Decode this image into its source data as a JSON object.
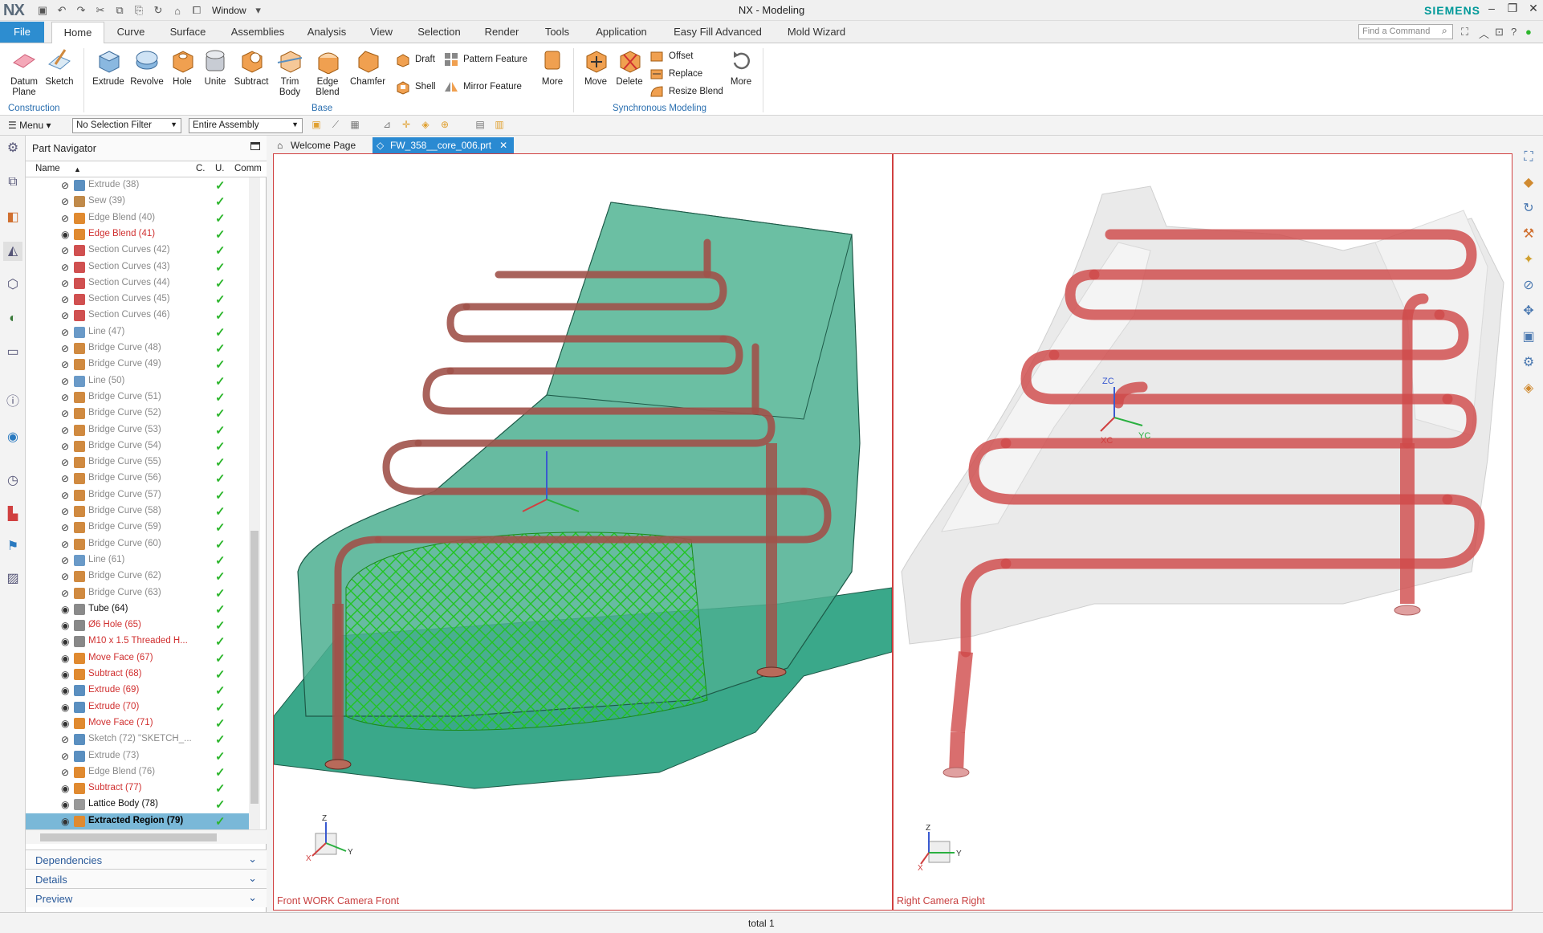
{
  "app": {
    "logo": "NX",
    "title": "NX - Modeling",
    "brand": "SIEMENS",
    "window_menu": "Window"
  },
  "tabs": {
    "file": "File",
    "items": [
      "Home",
      "Curve",
      "Surface",
      "Assemblies",
      "Analysis",
      "View",
      "Selection",
      "Render",
      "Tools",
      "Application",
      "Easy Fill Advanced",
      "Mold Wizard"
    ],
    "active": "Home",
    "find_placeholder": "Find a Command"
  },
  "ribbon": {
    "construction": {
      "group": "Construction",
      "datum": "Datum\nPlane",
      "sketch": "Sketch"
    },
    "base": {
      "group": "Base",
      "extrude": "Extrude",
      "revolve": "Revolve",
      "hole": "Hole",
      "unite": "Unite",
      "subtract": "Subtract",
      "trim_body": "Trim\nBody",
      "edge_blend": "Edge\nBlend",
      "chamfer": "Chamfer",
      "draft": "Draft",
      "shell": "Shell",
      "pattern": "Pattern Feature",
      "mirror": "Mirror Feature",
      "more": "More"
    },
    "sync": {
      "group": "Synchronous Modeling",
      "move": "Move",
      "delete": "Delete",
      "offset": "Offset",
      "replace": "Replace",
      "resize_blend": "Resize Blend",
      "more": "More"
    }
  },
  "selbar": {
    "menu": "Menu",
    "filter": "No Selection Filter",
    "scope": "Entire Assembly"
  },
  "navigator": {
    "title": "Part Navigator",
    "columns": {
      "name": "Name",
      "c": "C.",
      "u": "U.",
      "comment": "Comm"
    },
    "rows": [
      {
        "label": "Extrude (38)",
        "style": "gray",
        "icon": "#5a8fc0"
      },
      {
        "label": "Sew (39)",
        "style": "gray",
        "icon": "#c08a4a"
      },
      {
        "label": "Edge Blend (40)",
        "style": "gray",
        "icon": "#e08a30"
      },
      {
        "label": "Edge Blend (41)",
        "style": "red",
        "icon": "#e08a30"
      },
      {
        "label": "Section Curves (42)",
        "style": "gray",
        "icon": "#d05050"
      },
      {
        "label": "Section Curves (43)",
        "style": "gray",
        "icon": "#d05050"
      },
      {
        "label": "Section Curves (44)",
        "style": "gray",
        "icon": "#d05050"
      },
      {
        "label": "Section Curves (45)",
        "style": "gray",
        "icon": "#d05050"
      },
      {
        "label": "Section Curves (46)",
        "style": "gray",
        "icon": "#d05050"
      },
      {
        "label": "Line (47)",
        "style": "gray",
        "icon": "#6a9ac8"
      },
      {
        "label": "Bridge Curve (48)",
        "style": "gray",
        "icon": "#d08a40"
      },
      {
        "label": "Bridge Curve (49)",
        "style": "gray",
        "icon": "#d08a40"
      },
      {
        "label": "Line (50)",
        "style": "gray",
        "icon": "#6a9ac8"
      },
      {
        "label": "Bridge Curve (51)",
        "style": "gray",
        "icon": "#d08a40"
      },
      {
        "label": "Bridge Curve (52)",
        "style": "gray",
        "icon": "#d08a40"
      },
      {
        "label": "Bridge Curve (53)",
        "style": "gray",
        "icon": "#d08a40"
      },
      {
        "label": "Bridge Curve (54)",
        "style": "gray",
        "icon": "#d08a40"
      },
      {
        "label": "Bridge Curve (55)",
        "style": "gray",
        "icon": "#d08a40"
      },
      {
        "label": "Bridge Curve (56)",
        "style": "gray",
        "icon": "#d08a40"
      },
      {
        "label": "Bridge Curve (57)",
        "style": "gray",
        "icon": "#d08a40"
      },
      {
        "label": "Bridge Curve (58)",
        "style": "gray",
        "icon": "#d08a40"
      },
      {
        "label": "Bridge Curve (59)",
        "style": "gray",
        "icon": "#d08a40"
      },
      {
        "label": "Bridge Curve (60)",
        "style": "gray",
        "icon": "#d08a40"
      },
      {
        "label": "Line (61)",
        "style": "gray",
        "icon": "#6a9ac8"
      },
      {
        "label": "Bridge Curve (62)",
        "style": "gray",
        "icon": "#d08a40"
      },
      {
        "label": "Bridge Curve (63)",
        "style": "gray",
        "icon": "#d08a40"
      },
      {
        "label": "Tube (64)",
        "style": "black",
        "icon": "#8a8a8a"
      },
      {
        "label": "Ø6 Hole (65)",
        "style": "red",
        "icon": "#888"
      },
      {
        "label": "M10 x 1.5 Threaded H...",
        "style": "red",
        "icon": "#888"
      },
      {
        "label": "Move Face (67)",
        "style": "red",
        "icon": "#e08a30"
      },
      {
        "label": "Subtract (68)",
        "style": "red",
        "icon": "#e08a30"
      },
      {
        "label": "Extrude (69)",
        "style": "red",
        "icon": "#5a8fc0"
      },
      {
        "label": "Extrude (70)",
        "style": "red",
        "icon": "#5a8fc0"
      },
      {
        "label": "Move Face (71)",
        "style": "red",
        "icon": "#e08a30"
      },
      {
        "label": "Sketch (72) \"SKETCH_...",
        "style": "gray",
        "icon": "#5a8fc0"
      },
      {
        "label": "Extrude (73)",
        "style": "gray",
        "icon": "#5a8fc0"
      },
      {
        "label": "Edge Blend (76)",
        "style": "gray",
        "icon": "#e08a30"
      },
      {
        "label": "Subtract (77)",
        "style": "red",
        "icon": "#e08a30"
      },
      {
        "label": "Lattice Body (78)",
        "style": "black",
        "icon": "#999"
      },
      {
        "label": "Extracted Region (79)",
        "style": "sel",
        "icon": "#e08a30"
      }
    ],
    "panels": [
      "Dependencies",
      "Details",
      "Preview"
    ]
  },
  "graphics": {
    "tabs": [
      "Welcome Page",
      "FW_358__core_006.prt"
    ],
    "vp_left": "Front WORK Camera Front",
    "vp_right": "Right Camera Right"
  },
  "status": {
    "text": "total 1"
  },
  "colors": {
    "accent": "#2d8dd0",
    "brand": "#009999",
    "tube": "#d04a4a",
    "core": "#2e9b78",
    "lattice": "#22c422"
  }
}
